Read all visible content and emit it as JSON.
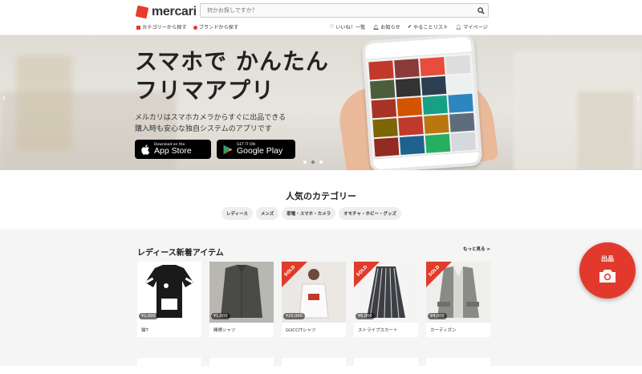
{
  "header": {
    "logo_text": "mercari",
    "search_placeholder": "何かお探しですか？",
    "nav_left": [
      "カテゴリーから探す",
      "ブランドから探す"
    ],
    "nav_right": [
      "いいね！一覧",
      "お知らせ",
      "やることリスト",
      "マイページ"
    ]
  },
  "hero": {
    "headline_1": "スマホで かんたん",
    "headline_2": "フリマアプリ",
    "sub_1": "メルカリはスマホカメラからすぐに出品できる",
    "sub_2": "購入時も安心な独自システムのアプリです",
    "appstore_small": "Download on the",
    "appstore_big": "App Store",
    "googleplay_small": "GET IT ON",
    "googleplay_big": "Google Play",
    "slide_count": 3,
    "active_slide": 1
  },
  "categories": {
    "title": "人気のカテゴリー",
    "items": [
      "レディース",
      "メンズ",
      "家電・スマホ・カメラ",
      "オモチャ・ホビー・グッズ"
    ]
  },
  "ladies_new": {
    "title": "レディース新着アイテム",
    "more_label": "もっと見る >",
    "sold_label": "SOLD",
    "items": [
      {
        "name": "猫T",
        "price": "¥2,000",
        "sold": false
      },
      {
        "name": "開襟シャツ",
        "price": "¥1,600",
        "sold": false
      },
      {
        "name": "GUCCITシャツ",
        "price": "¥20,000",
        "sold": true
      },
      {
        "name": "ストライプスカート",
        "price": "¥6,000",
        "sold": true
      },
      {
        "name": "カーディガン",
        "price": "¥4,000",
        "sold": true
      }
    ]
  },
  "fab": {
    "label": "出品"
  },
  "colors": {
    "brand_red": "#e3392d",
    "text": "#333333"
  }
}
